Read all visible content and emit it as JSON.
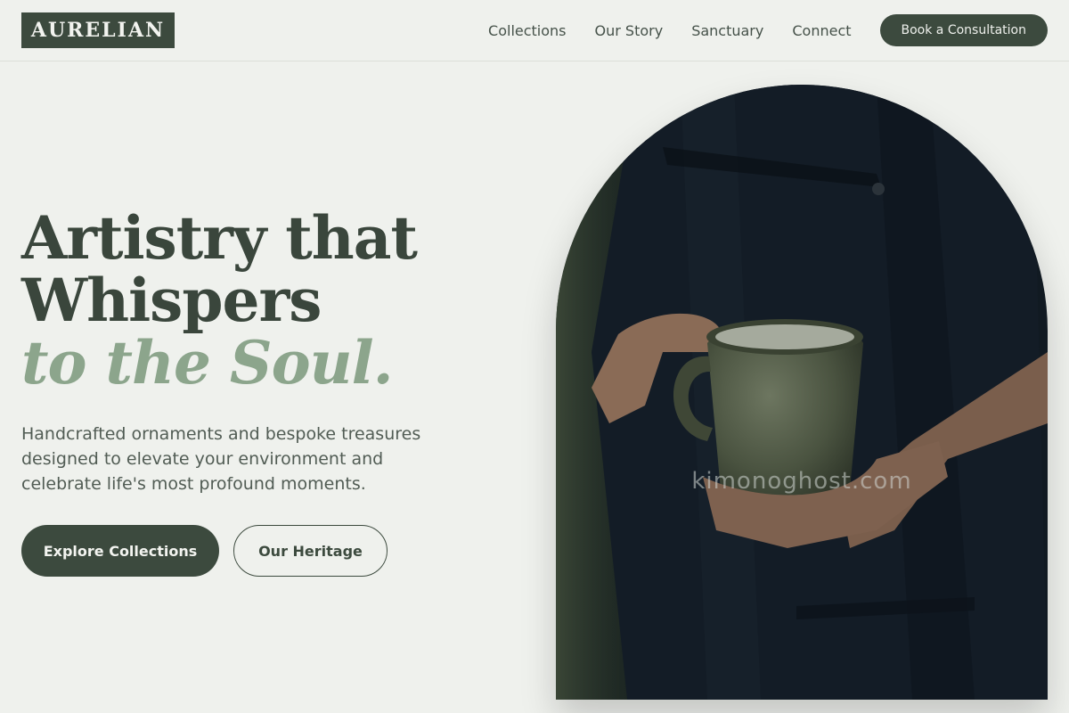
{
  "brand": {
    "name": "AURELIAN"
  },
  "nav": {
    "items": [
      "Collections",
      "Our Story",
      "Sanctuary",
      "Connect"
    ],
    "cta_label": "Book a Consultation"
  },
  "hero": {
    "title_line1": "Artistry that",
    "title_line2": "Whispers",
    "title_accent": "to the Soul.",
    "subtitle": "Handcrafted ornaments and bespoke treasures designed to elevate your environment and celebrate life's most profound moments.",
    "primary_button": "Explore Collections",
    "secondary_button": "Our Heritage",
    "image_watermark": "kimonoghost.com"
  },
  "colors": {
    "background": "#eff1ed",
    "brand_dark": "#3c4a3e",
    "accent_sage": "#8ca58c",
    "text": "#3a463c"
  }
}
